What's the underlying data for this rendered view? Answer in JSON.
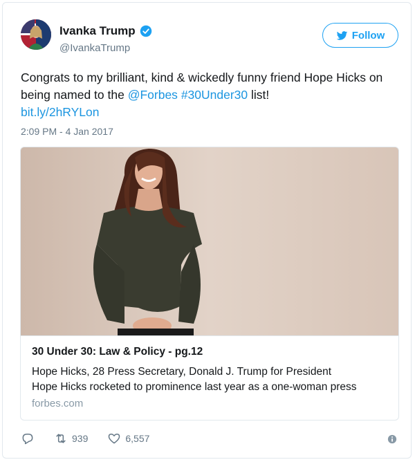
{
  "author": {
    "name": "Ivanka Trump",
    "handle": "@IvankaTrump"
  },
  "follow_label": "Follow",
  "tweet": {
    "text_part1": "Congrats to my brilliant, kind & wickedly funny friend Hope Hicks on being named to the ",
    "mention": "@Forbes",
    "text_space": " ",
    "hashtag": "#30Under30",
    "text_part2": " list!",
    "url": "bit.ly/2hRYLon",
    "timestamp": "2:09 PM - 4 Jan 2017"
  },
  "card": {
    "title": "30 Under 30: Law & Policy - pg.12",
    "desc_line1": "Hope Hicks, 28 Press Secretary, Donald J. Trump for President",
    "desc_line2": "Hope Hicks rocketed to prominence last year as a one-woman press",
    "domain": "forbes.com"
  },
  "actions": {
    "reply_icon": "reply-icon",
    "retweet_count": "939",
    "like_count": "6,557"
  },
  "colors": {
    "accent": "#1da1f2",
    "link": "#1b95e0",
    "muted": "#657786"
  }
}
